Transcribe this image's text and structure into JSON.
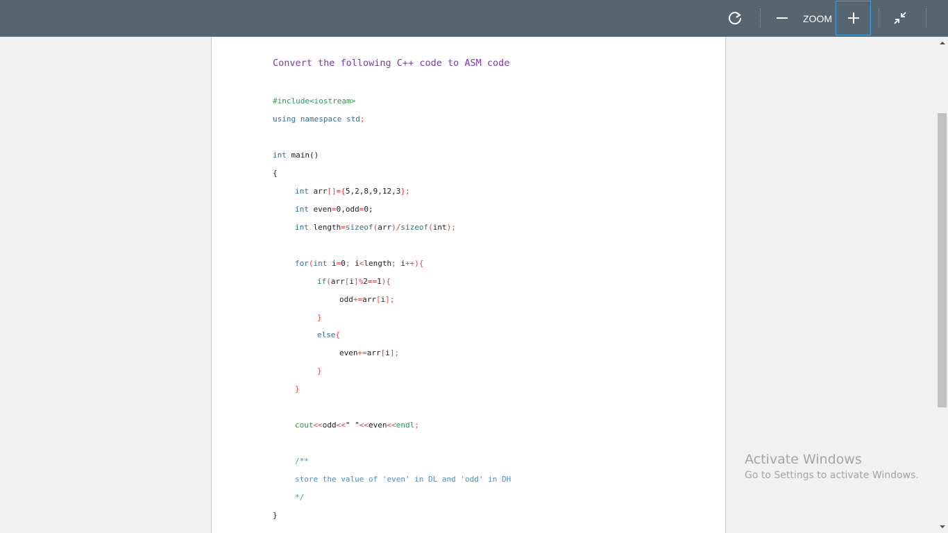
{
  "toolbar": {
    "zoom_label": "ZOOM",
    "icons": [
      "refresh-icon",
      "minus-icon",
      "plus-icon",
      "exit-fullscreen-icon"
    ],
    "accent": "#3aa0e8"
  },
  "document": {
    "heading": "Convert the following C++ code to ASM code",
    "code": {
      "l1": "#include<iostream>",
      "l2a": "using namespace std",
      "l2b": ";",
      "l3a": "int",
      "l3b": " main()",
      "l4": "{",
      "l5a": "int",
      "l5b": " arr",
      "l5c": "[]={",
      "l5d": "5,2,8,9,12,3",
      "l5e": "};",
      "l6a": "int",
      "l6b": " even",
      "l6c": "=",
      "l6d": "0,odd",
      "l6e": "=",
      "l6f": "0;",
      "l7a": "int",
      "l7b": " length",
      "l7c": "=",
      "l7d": "sizeof",
      "l7e": "(",
      "l7f": "arr",
      "l7g": ")/",
      "l7h": "sizeof",
      "l7i": "(",
      "l7j": "int",
      "l7k": ");",
      "l8a": "for",
      "l8b": "(",
      "l8c": "int",
      "l8d": " i",
      "l8e": "=",
      "l8f": "0",
      "l8g": ";",
      "l8h": " i",
      "l8i": "<",
      "l8j": "length",
      "l8k": ";",
      "l8l": " i",
      "l8m": "++){",
      "l9a": "if",
      "l9b": "(",
      "l9c": "arr",
      "l9d": "[",
      "l9e": "i",
      "l9f": "]%",
      "l9g": "2",
      "l9h": "==",
      "l9i": "1",
      "l9j": "){",
      "l10a": "odd",
      "l10b": "+=",
      "l10c": "arr",
      "l10d": "[",
      "l10e": "i",
      "l10f": "];",
      "l11": "}",
      "l12a": "else",
      "l12b": "{",
      "l13a": "even",
      "l13b": "+=",
      "l13c": "arr",
      "l13d": "[",
      "l13e": "i",
      "l13f": "];",
      "l14": "}",
      "l15": "}",
      "l16a": "cout",
      "l16b": "<<",
      "l16c": "odd",
      "l16d": "<<",
      "l16e": "\" \"",
      "l16f": "<<",
      "l16g": "even",
      "l16h": "<<",
      "l16i": "endl",
      "l16j": ";",
      "l17": "/**",
      "l18": "store the value of 'even' in DL and 'odd' in DH",
      "l19": "*/",
      "l20": "}"
    }
  },
  "watermark": {
    "title": "Activate Windows",
    "subtitle": "Go to Settings to activate Windows."
  }
}
